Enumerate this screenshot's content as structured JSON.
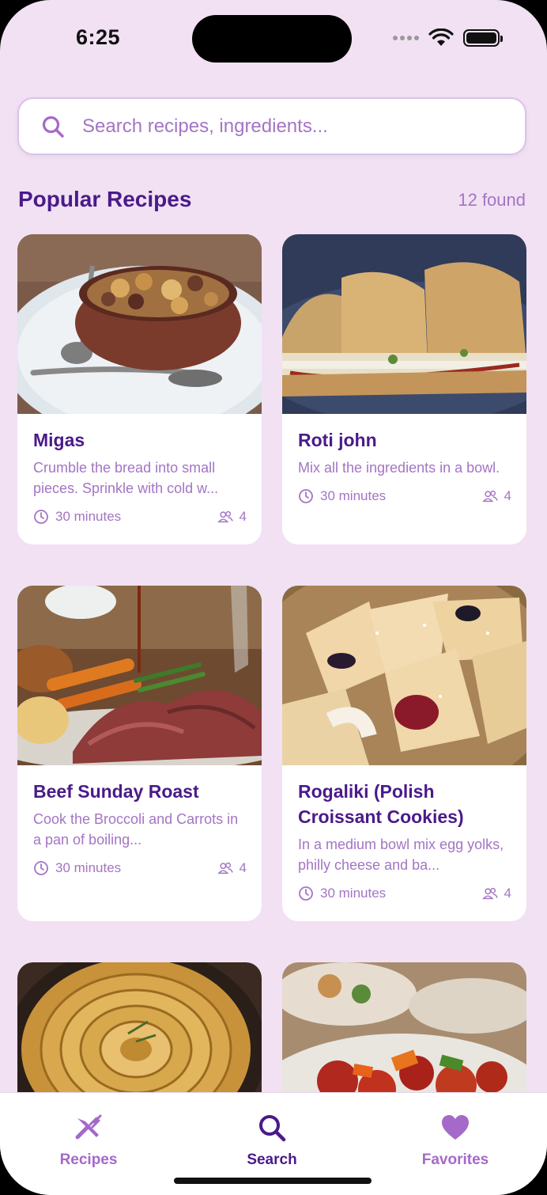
{
  "status_bar": {
    "time": "6:25"
  },
  "search": {
    "placeholder": "Search recipes, ingredients...",
    "value": ""
  },
  "section": {
    "title": "Popular Recipes",
    "count_label": "12 found"
  },
  "recipes": [
    {
      "title": "Migas",
      "description": "Crumble the bread into small pieces. Sprinkle with cold w...",
      "time": "30 minutes",
      "servings": "4"
    },
    {
      "title": "Roti john",
      "description": "Mix all the ingredients in a bowl.",
      "time": "30 minutes",
      "servings": "4"
    },
    {
      "title": "Beef Sunday Roast",
      "description": "Cook the Broccoli and Carrots in a pan of boiling...",
      "time": "30 minutes",
      "servings": "4"
    },
    {
      "title": "Rogaliki (Polish Croissant Cookies)",
      "description": "In a medium bowl mix egg yolks, philly cheese and ba...",
      "time": "30 minutes",
      "servings": "4"
    },
    {
      "title": "",
      "description": "",
      "time": "",
      "servings": ""
    },
    {
      "title": "",
      "description": "",
      "time": "",
      "servings": ""
    }
  ],
  "tabs": [
    {
      "label": "Recipes",
      "icon": "fork-knife-icon",
      "active": false
    },
    {
      "label": "Search",
      "icon": "search-icon",
      "active": true
    },
    {
      "label": "Favorites",
      "icon": "heart-icon",
      "active": false
    }
  ],
  "colors": {
    "background": "#f1e1f3",
    "primary": "#4a1a8a",
    "accent": "#a375c4",
    "card": "#ffffff"
  }
}
